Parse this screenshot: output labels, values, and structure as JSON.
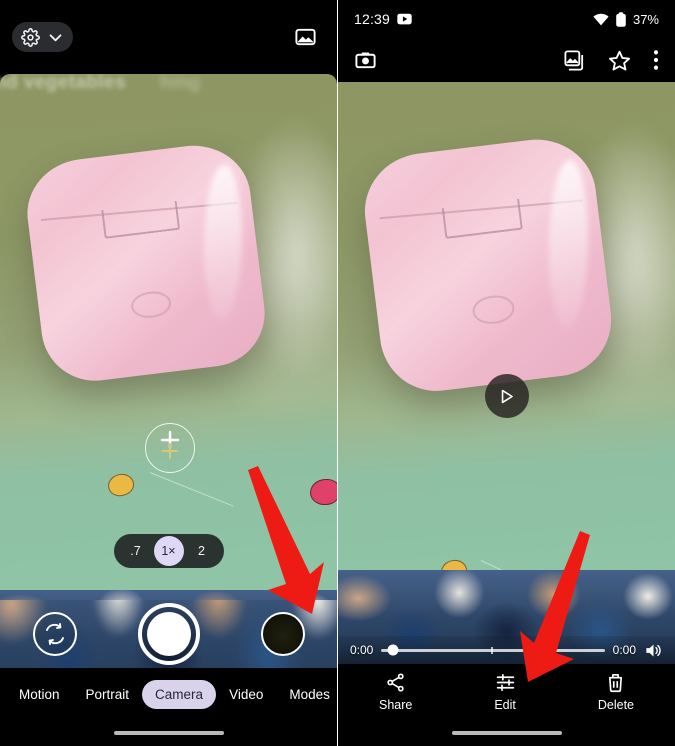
{
  "left_panel": {
    "name": "camera-app",
    "topbar": {
      "settings_icon": "gear-icon",
      "expand_icon": "chevron-down-icon",
      "gallery_icon": "photo-library-icon"
    },
    "overlay_text": {
      "line1": "nd vegetables",
      "line2": "hing"
    },
    "focus_reticle": "focus-reticle",
    "zoom": {
      "options": [
        ".7",
        "1×",
        "2"
      ],
      "selected": "1×"
    },
    "controls": {
      "flip_icon": "camera-flip-icon",
      "shutter_label": "shutter-button",
      "thumbnail_label": "last-photo-thumbnail"
    },
    "modes": [
      {
        "label": "Motion",
        "active": false
      },
      {
        "label": "Portrait",
        "active": false
      },
      {
        "label": "Camera",
        "active": true
      },
      {
        "label": "Video",
        "active": false
      },
      {
        "label": "Modes",
        "active": false
      }
    ]
  },
  "right_panel": {
    "name": "photo-viewer",
    "status_bar": {
      "time": "12:39",
      "notification_icon": "youtube-icon",
      "wifi_icon": "wifi-icon",
      "battery_icon": "battery-icon",
      "battery_level": "37%"
    },
    "toolbar": {
      "camera_icon": "camera-icon",
      "library_icon": "photo-stack-icon",
      "favorite_icon": "star-icon",
      "overflow_icon": "more-vertical-icon"
    },
    "player": {
      "play_icon": "play-icon",
      "current_time": "0:00",
      "total_time": "0:00",
      "volume_icon": "volume-icon",
      "progress_percent": 5
    },
    "actions": [
      {
        "label": "Share",
        "icon": "share-icon"
      },
      {
        "label": "Edit",
        "icon": "tune-icon"
      },
      {
        "label": "Delete",
        "icon": "trash-icon"
      }
    ]
  },
  "annotations": {
    "arrow_color": "#ee1b14",
    "arrow_left_target": "last-photo-thumbnail",
    "arrow_right_target": "edit-action"
  }
}
